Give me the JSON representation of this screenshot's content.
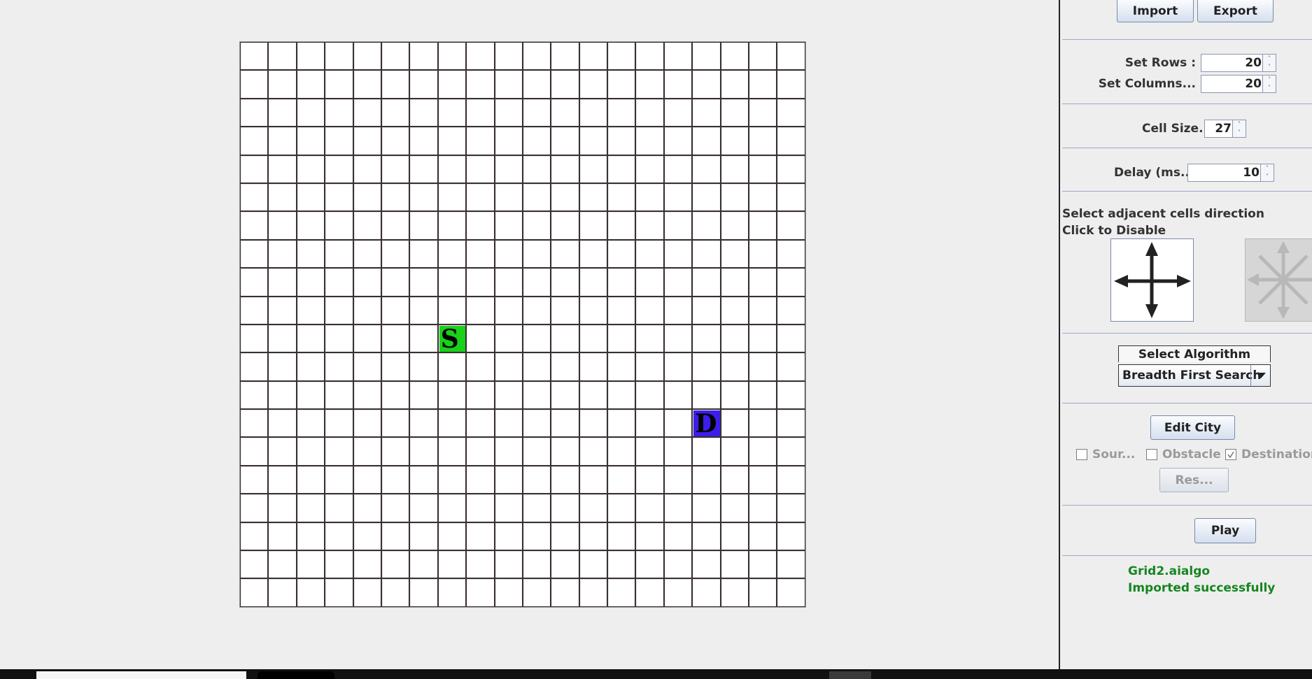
{
  "toolbar": {
    "import_label": "Import",
    "export_label": "Export"
  },
  "settings": {
    "rows_label": "Set Rows :",
    "rows_value": "20",
    "cols_label": "Set Columns...",
    "cols_value": "20",
    "cell_size_label": "Cell Size...",
    "cell_size_value": "27",
    "delay_label": "Delay (ms...",
    "delay_value": "10"
  },
  "direction": {
    "line1": "Select adjacent cells direction",
    "line2": "Click to Disable",
    "options": [
      {
        "icon": "four-direction-arrows-icon",
        "state": "enabled"
      },
      {
        "icon": "eight-direction-arrows-icon",
        "state": "disabled"
      }
    ]
  },
  "algorithm": {
    "title": "Select Algorithm",
    "selected": "Breadth First Search"
  },
  "edit": {
    "edit_label": "Edit City",
    "source_label": "Sour...",
    "source_checked": false,
    "obstacle_label": "Obstacle",
    "obstacle_checked": false,
    "destination_label": "Destination",
    "destination_checked": true,
    "reset_label": "Res..."
  },
  "play_label": "Play",
  "status": {
    "line1": "Grid2.aialgo",
    "line2": "Imported successfully"
  },
  "grid": {
    "rows": 20,
    "cols": 20,
    "source": {
      "row": 10,
      "col": 7,
      "label": "S",
      "color": "#19d119"
    },
    "destination": {
      "row": 13,
      "col": 16,
      "label": "D",
      "color": "#3c1eea"
    }
  },
  "colors": {
    "status": "#15861f",
    "panel_bg": "#eeeeee"
  }
}
